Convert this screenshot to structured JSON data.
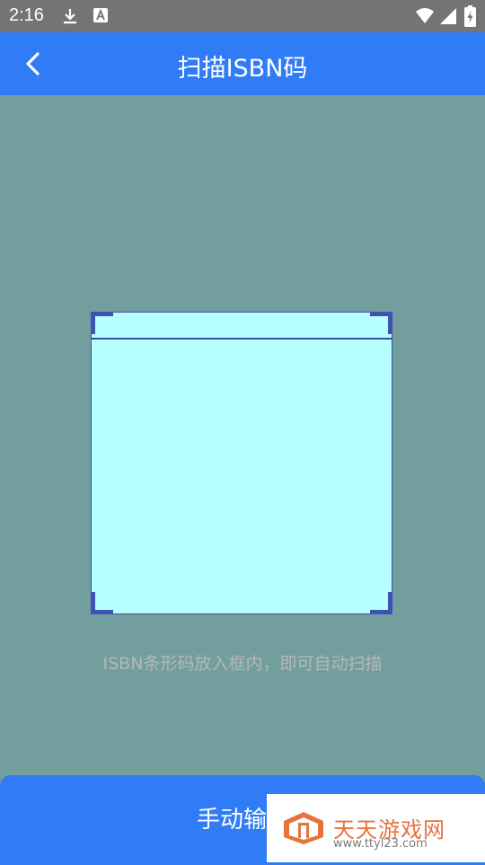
{
  "status_bar": {
    "time": "2:16"
  },
  "app_bar": {
    "title": "扫描ISBN码"
  },
  "scanner": {
    "hint": "ISBN条形码放入框内，即可自动扫描"
  },
  "footer": {
    "manual_label": "手动输"
  },
  "watermark": {
    "title": "天天游戏网",
    "url": "www.ttyl23.com"
  },
  "colors": {
    "primary": "#2f7cf6",
    "background": "#739e9e",
    "scan_frame": "#b5ffff",
    "corner": "#3f51b5"
  }
}
